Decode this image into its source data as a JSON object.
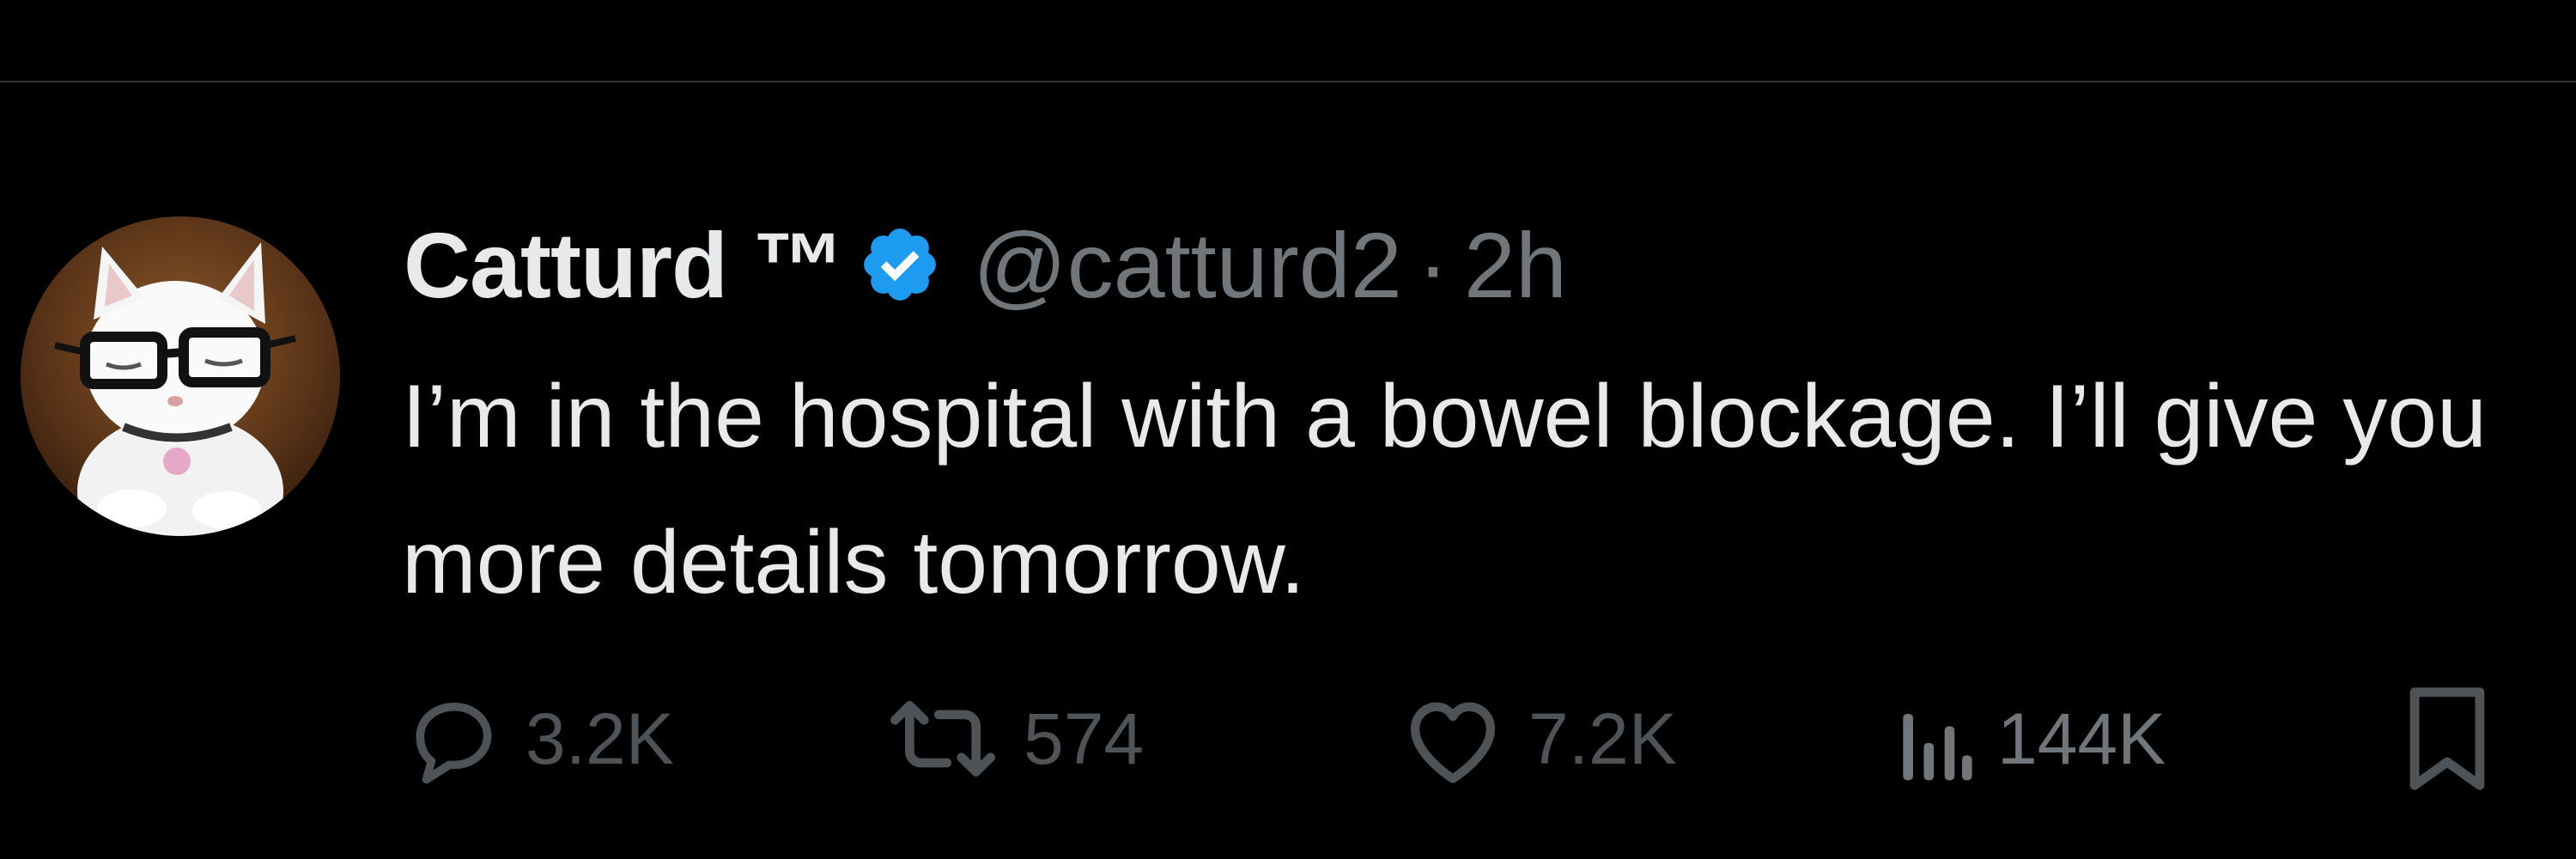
{
  "tweet": {
    "author_name": "Catturd ™",
    "verified_icon": "verified-badge-icon",
    "handle": "@catturd2",
    "separator": "·",
    "timestamp": "2h",
    "text": "I’m in the hospital with a bowel blockage. I’ll give you more details tomorrow."
  },
  "avatar": {
    "icon": "cat-with-glasses-avatar"
  },
  "actions": {
    "reply": {
      "icon": "reply-icon",
      "count": "3.2K"
    },
    "retweet": {
      "icon": "retweet-icon",
      "count": "574"
    },
    "like": {
      "icon": "heart-icon",
      "count": "7.2K"
    },
    "views": {
      "icon": "views-chart-icon",
      "count": "144K"
    },
    "bookmark": {
      "icon": "bookmark-icon"
    }
  },
  "colors": {
    "background": "#000000",
    "primary_text": "#e7e9ea",
    "secondary_text": "#71767b",
    "action_muted": "#4e5358",
    "verified_blue": "#1d9bf0",
    "divider": "#2f3336"
  }
}
